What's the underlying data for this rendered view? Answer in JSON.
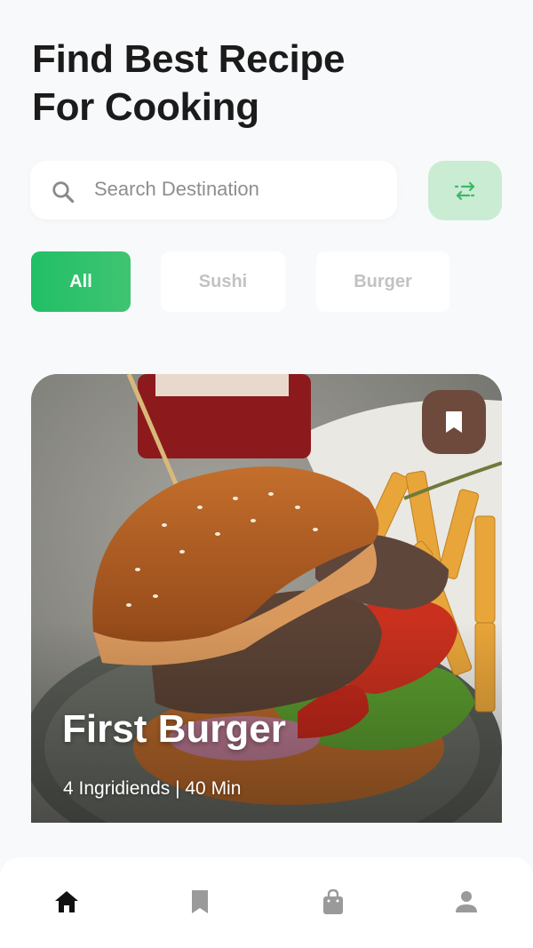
{
  "header": {
    "title_line1": "Find Best Recipe",
    "title_line2": "For Cooking"
  },
  "search": {
    "placeholder": "Search Destination",
    "icon": "search-icon"
  },
  "filter_button": {
    "icon": "swap-arrows-icon",
    "color": "#c9ecd3"
  },
  "categories": [
    {
      "label": "All",
      "active": true
    },
    {
      "label": "Sushi",
      "active": false
    },
    {
      "label": "Burger",
      "active": false
    }
  ],
  "featured_card": {
    "title": "First Burger",
    "meta": "4 Ingridiends | 40 Min",
    "bookmark_icon": "bookmark-icon",
    "bookmark_color": "#6e4a3d"
  },
  "bottom_nav": [
    {
      "name": "home",
      "icon": "home-icon",
      "active": true
    },
    {
      "name": "saved",
      "icon": "bookmark-icon",
      "active": false
    },
    {
      "name": "shop",
      "icon": "shopping-bag-icon",
      "active": false
    },
    {
      "name": "profile",
      "icon": "user-icon",
      "active": false
    }
  ],
  "colors": {
    "accent": "#21bf66",
    "background": "#f8f9fb",
    "text_primary": "#1b1b1b",
    "text_muted": "#c2c2c2"
  }
}
